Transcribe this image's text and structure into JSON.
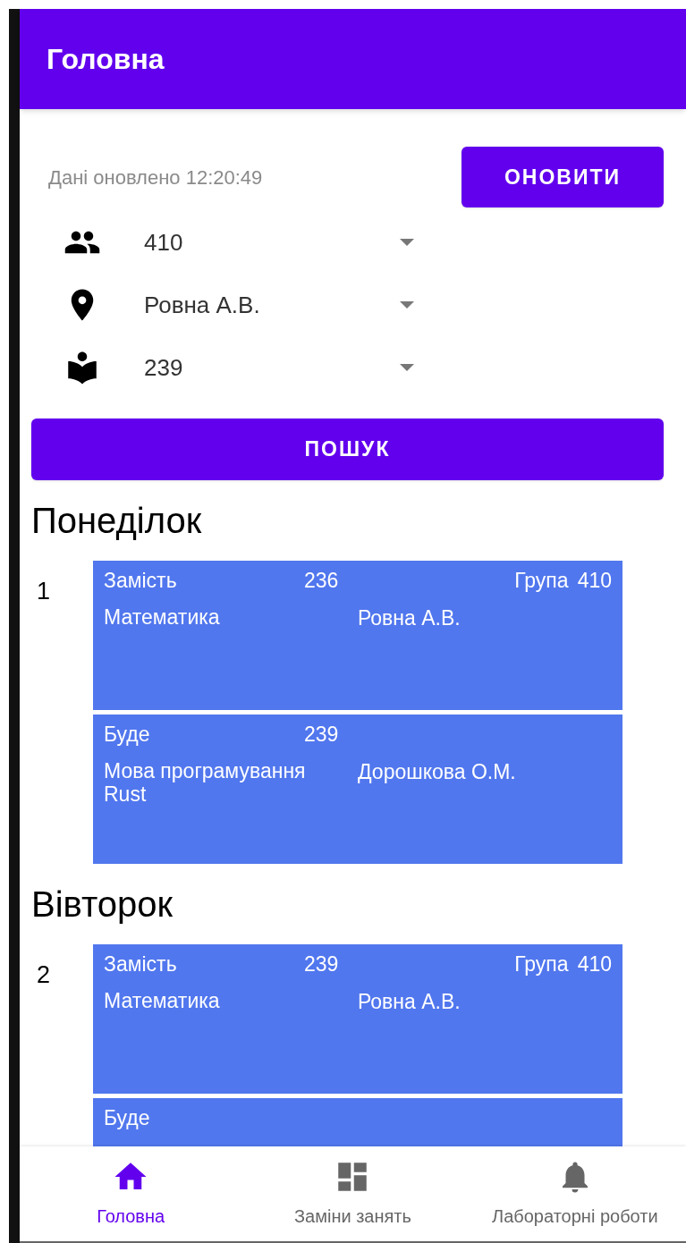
{
  "app_bar": {
    "title": "Головна"
  },
  "updated": "Дані оновлено 12:20:49",
  "refresh_button": "ОНОВИТИ",
  "filters": [
    {
      "kind": "group",
      "value": "410"
    },
    {
      "kind": "teacher",
      "value": "Ровна А.В."
    },
    {
      "kind": "room",
      "value": "239"
    }
  ],
  "search_button": "ПОШУК",
  "days": [
    {
      "title": "Понеділок",
      "lessons": [
        {
          "number": "1",
          "entries": [
            {
              "label": "Замість",
              "room": "236",
              "group_label": "Група",
              "group": "410",
              "subject": "Математика",
              "teacher": "Ровна А.В."
            },
            {
              "label": "Буде",
              "room": "239",
              "subject": "Мова програмування Rust",
              "teacher": "Дорошкова О.М."
            }
          ]
        }
      ]
    },
    {
      "title": "Вівторок",
      "lessons": [
        {
          "number": "2",
          "entries": [
            {
              "label": "Замість",
              "room": "239",
              "group_label": "Група",
              "group": "410",
              "subject": "Математика",
              "teacher": "Ровна А.В."
            },
            {
              "label": "Буде"
            }
          ]
        }
      ]
    }
  ],
  "bottom_nav": [
    {
      "kind": "home",
      "label": "Головна",
      "selected": true
    },
    {
      "kind": "dashboard",
      "label": "Заміни занять",
      "selected": false
    },
    {
      "kind": "bell",
      "label": "Лабораторні роботи",
      "selected": false
    }
  ]
}
